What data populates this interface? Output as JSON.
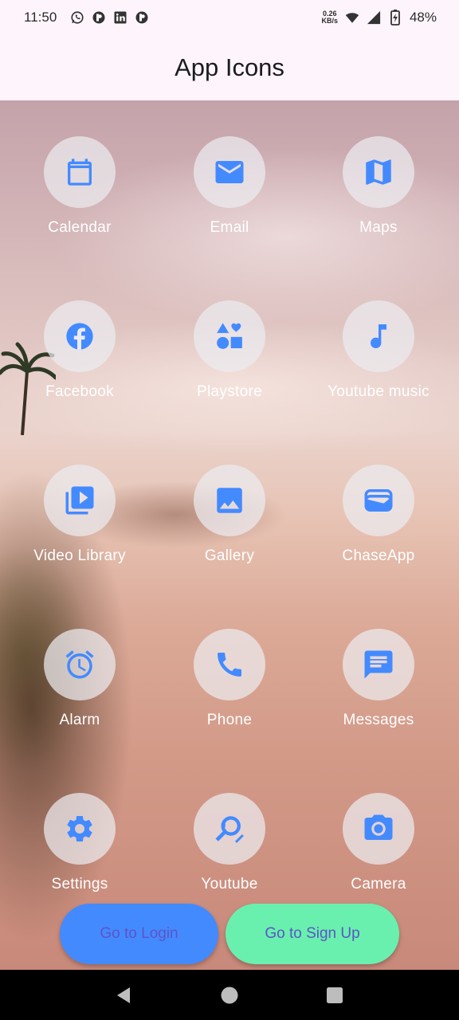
{
  "status_bar": {
    "time": "11:50",
    "net_speed_value": "0.26",
    "net_speed_unit": "KB/s",
    "battery": "48%",
    "notification_icons": [
      "whatsapp-icon",
      "app-icon",
      "linkedin-icon",
      "app-icon"
    ]
  },
  "app_bar": {
    "title": "App Icons"
  },
  "apps": [
    {
      "label": "Calendar",
      "icon": "calendar-icon"
    },
    {
      "label": "Email",
      "icon": "email-icon"
    },
    {
      "label": "Maps",
      "icon": "map-icon"
    },
    {
      "label": "Facebook",
      "icon": "facebook-icon"
    },
    {
      "label": "Playstore",
      "icon": "category-icon"
    },
    {
      "label": "Youtube music",
      "icon": "music-note-icon"
    },
    {
      "label": "Video Library",
      "icon": "video-library-icon"
    },
    {
      "label": "Gallery",
      "icon": "image-icon"
    },
    {
      "label": "ChaseApp",
      "icon": "wallet-icon"
    },
    {
      "label": "Alarm",
      "icon": "alarm-icon"
    },
    {
      "label": "Phone",
      "icon": "phone-icon"
    },
    {
      "label": "Messages",
      "icon": "message-icon"
    },
    {
      "label": "Settings",
      "icon": "settings-icon"
    },
    {
      "label": "Youtube",
      "icon": "search-icon"
    },
    {
      "label": "Camera",
      "icon": "camera-icon"
    }
  ],
  "buttons": {
    "login": "Go to Login",
    "signup": "Go to Sign Up"
  },
  "colors": {
    "icon": "#448aff",
    "login_button": "#448aff",
    "signup_button": "#69f0ae",
    "button_text": "#5c55c7"
  }
}
